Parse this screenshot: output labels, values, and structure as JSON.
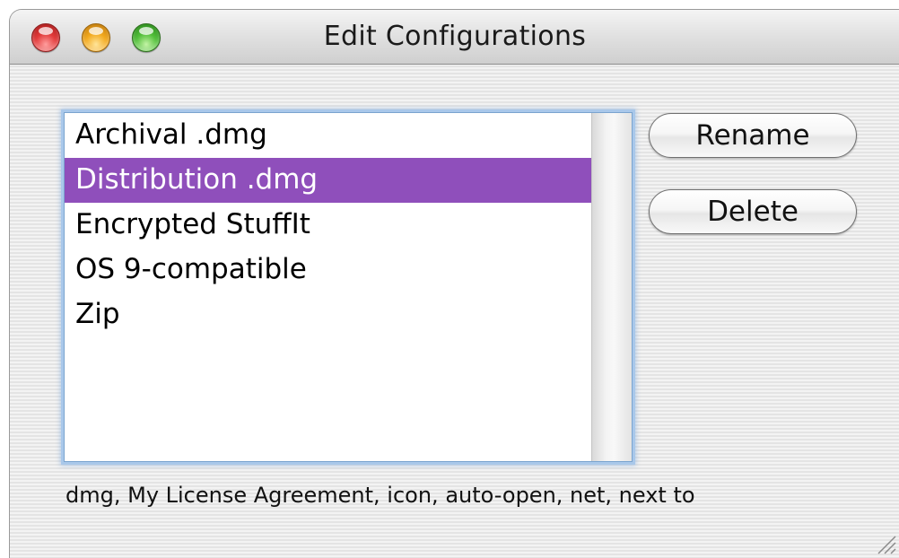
{
  "window": {
    "title": "Edit Configurations"
  },
  "configurations": {
    "items": [
      {
        "label": "Archival .dmg",
        "selected": false
      },
      {
        "label": "Distribution .dmg",
        "selected": true
      },
      {
        "label": "Encrypted StuffIt",
        "selected": false
      },
      {
        "label": "OS 9-compatible",
        "selected": false
      },
      {
        "label": "Zip",
        "selected": false
      }
    ],
    "selection_color": "#8f4fbb"
  },
  "buttons": {
    "rename_label": "Rename",
    "delete_label": "Delete"
  },
  "summary": {
    "text": "dmg, My License Agreement, icon, auto-open, net, next to"
  },
  "icons": {
    "close": "close-button-red",
    "minimize": "minimize-button-yellow",
    "zoom": "zoom-button-green",
    "resize": "resize-grip-icon"
  }
}
